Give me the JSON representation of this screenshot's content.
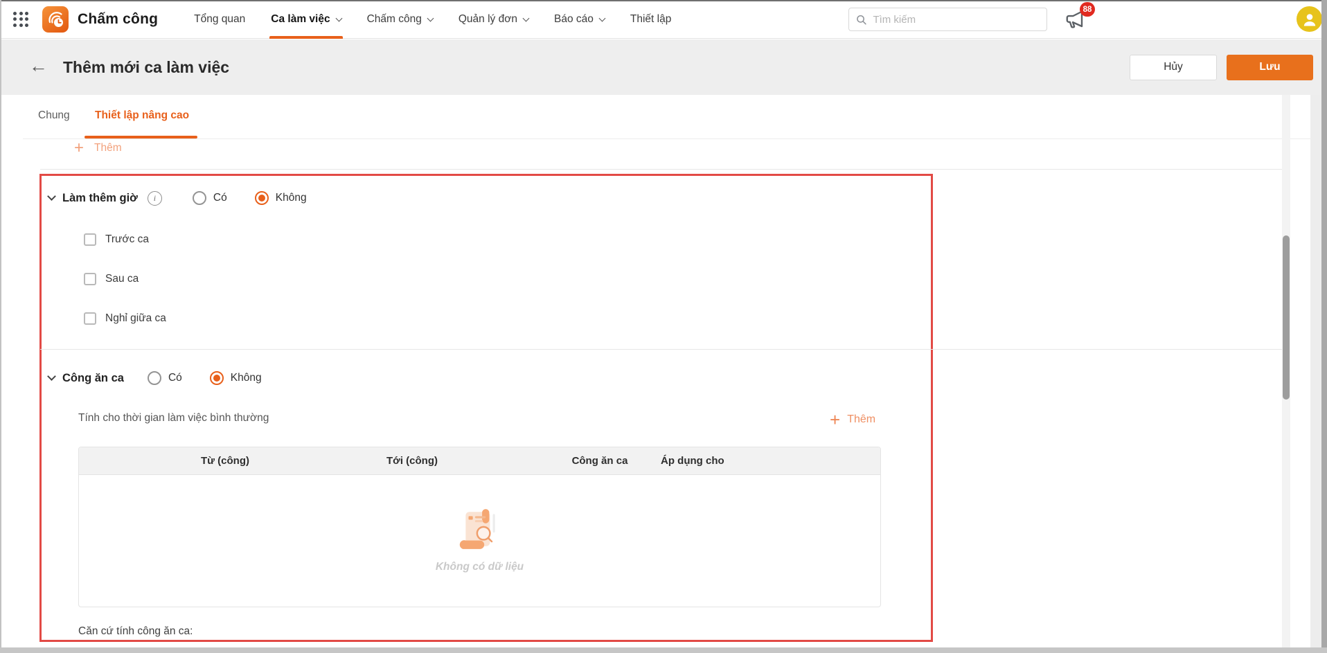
{
  "topnav": {
    "app_name": "Chấm công",
    "items": [
      {
        "label": "Tổng quan"
      },
      {
        "label": "Ca làm việc"
      },
      {
        "label": "Chấm công"
      },
      {
        "label": "Quản lý đơn"
      },
      {
        "label": "Báo cáo"
      },
      {
        "label": "Thiết lập"
      }
    ],
    "active_item": "Ca làm việc",
    "search_placeholder": "Tìm kiếm",
    "notification_badge": "88"
  },
  "header": {
    "title": "Thêm mới ca làm việc",
    "cancel": "Hủy",
    "save": "Lưu"
  },
  "tabs": {
    "general": "Chung",
    "advanced": "Thiết lập nâng cao",
    "active": "Thiết lập nâng cao"
  },
  "body": {
    "add_item_top": "Thêm",
    "overtime": {
      "title": "Làm thêm giờ",
      "option_yes": "Có",
      "option_no": "Không",
      "selected": "Không",
      "checkboxes": [
        "Trước ca",
        "Sau ca",
        "Nghỉ giữa ca"
      ]
    },
    "meal": {
      "title": "Công ăn ca",
      "option_yes": "Có",
      "option_no": "Không",
      "selected": "Không",
      "note": "Tính cho thời gian làm việc bình thường",
      "add_row": "Thêm",
      "table_headers": [
        "Từ (công)",
        "Tới (công)",
        "Công ăn ca",
        "Áp dụng cho"
      ],
      "empty_text": "Không có dữ liệu",
      "basis_label": "Căn cứ tính công ăn ca:"
    }
  },
  "icons": {
    "back_arrow": "←",
    "plus": "+",
    "info": "i"
  },
  "colors": {
    "accent": "#e8601b",
    "save_bg": "#e8701c",
    "highlight_border": "#e24a45",
    "badge_bg": "#e12a20",
    "avatar_bg": "#e7c31b"
  }
}
